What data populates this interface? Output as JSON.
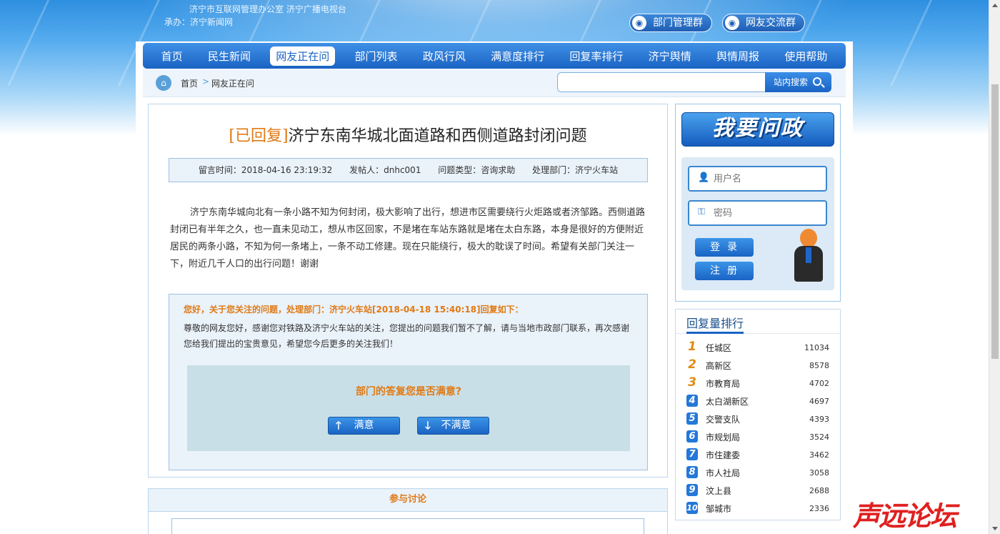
{
  "header": {
    "organizer": "济宁市互联网管理办公室  济宁广播电视台",
    "host": "承办：济宁新闻网",
    "qq_groups": [
      "部门管理群",
      "网友交流群"
    ]
  },
  "nav": {
    "items": [
      "首页",
      "民生新闻",
      "网友正在问",
      "部门列表",
      "政风行风",
      "满意度排行",
      "回复率排行",
      "济宁舆情",
      "舆情周报",
      "使用帮助"
    ],
    "active_index": 2
  },
  "breadcrumb": {
    "home": "首页",
    "separator": ">",
    "current": "网友正在问"
  },
  "search": {
    "placeholder": "",
    "button_label": "站内搜索"
  },
  "article": {
    "status_tag": "[已回复]",
    "title": "济宁东南华城北面道路和西侧道路封闭问题",
    "meta": {
      "time": "留言时间：2018-04-16 23:19:32",
      "author": "发帖人：dnhc001",
      "type": "问题类型：咨询求助",
      "dept": "处理部门：济宁火车站"
    },
    "body": "济宁东南华城向北有一条小路不知为何封闭，极大影响了出行，想进市区需要绕行火炬路或者济邹路。西侧道路封闭已有半年之久，也一直未见动工，想从市区回家，不是堵在车站东路就是堵在太白东路，本身是很好的方便附近居民的两条小路，不知为何一条堵上，一条不动工修建。现在只能绕行，极大的耽误了时间。希望有关部门关注一下，附近几千人口的出行问题！谢谢"
  },
  "reply": {
    "heading": "您好，关于您关注的问题，处理部门：济宁火车站[2018-04-18 15:40:18]回复如下：",
    "text": "尊敬的网友您好，感谢您对铁路及济宁火车站的关注，您提出的问题我们暂不了解，请与当地市政部门联系，再次感谢您给我们提出的宝贵意见，希望您今后更多的关注我们！",
    "satisfaction_question": "部门的答复您是否满意?",
    "satisfied_label": "满意",
    "unsatisfied_label": "不满意"
  },
  "discussion": {
    "heading": "参与讨论"
  },
  "login": {
    "banner": "我要问政",
    "username_placeholder": "用户名",
    "password_placeholder": "密码",
    "login_label": "登录",
    "register_label": "注册"
  },
  "ranking": {
    "title": "回复量排行",
    "items": [
      {
        "rank": "1",
        "name": "任城区",
        "count": "11034"
      },
      {
        "rank": "2",
        "name": "高新区",
        "count": "8578"
      },
      {
        "rank": "3",
        "name": "市教育局",
        "count": "4702"
      },
      {
        "rank": "4",
        "name": "太白湖新区",
        "count": "4697"
      },
      {
        "rank": "5",
        "name": "交警支队",
        "count": "4393"
      },
      {
        "rank": "6",
        "name": "市规划局",
        "count": "3524"
      },
      {
        "rank": "7",
        "name": "市住建委",
        "count": "3462"
      },
      {
        "rank": "8",
        "name": "市人社局",
        "count": "3058"
      },
      {
        "rank": "9",
        "name": "汶上县",
        "count": "2688"
      },
      {
        "rank": "10",
        "name": "邹城市",
        "count": "2336"
      }
    ]
  },
  "watermark": "声远论坛",
  "colors": {
    "primary_blue": "#1a63c4",
    "accent_orange": "#e07a14",
    "panel_bg": "#eaf2fa"
  }
}
